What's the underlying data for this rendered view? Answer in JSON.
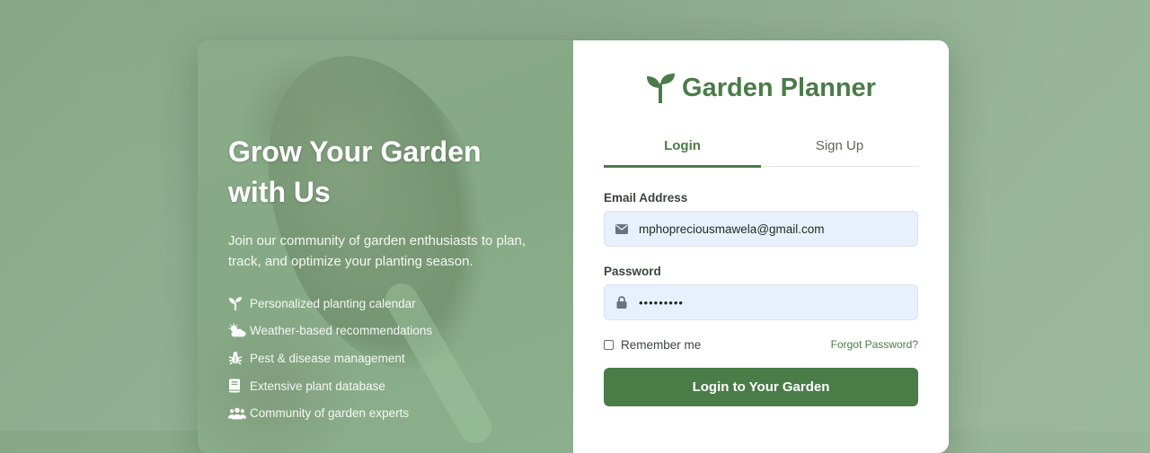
{
  "brand": {
    "title": "Garden Planner",
    "icon": "sprout-icon",
    "color": "#4a7c48"
  },
  "hero": {
    "title_line1": "Grow Your Garden",
    "title_line2": "with Us",
    "subtitle_line1": "Join our community of garden enthusiasts to plan,",
    "subtitle_line2": "track, and optimize your planting season.",
    "features": [
      {
        "label": "Personalized planting calendar",
        "icon": "seedling-icon"
      },
      {
        "label": "Weather-based recommendations",
        "icon": "sun-cloud-icon"
      },
      {
        "label": "Pest & disease management",
        "icon": "bug-icon"
      },
      {
        "label": "Extensive plant database",
        "icon": "book-icon"
      },
      {
        "label": "Community of garden experts",
        "icon": "users-icon"
      }
    ]
  },
  "tabs": [
    {
      "label": "Login",
      "active": true
    },
    {
      "label": "Sign Up",
      "active": false
    }
  ],
  "form": {
    "email_label": "Email Address",
    "email_value": "mphopreciousmawela@gmail.com",
    "password_label": "Password",
    "password_value": "•••••••••",
    "remember_label": "Remember me",
    "forgot_label": "Forgot Password?",
    "submit_label": "Login to Your Garden"
  },
  "colors": {
    "accent": "#4a7c48",
    "input_bg": "#e8f0fe",
    "background": "#8fae8e"
  }
}
